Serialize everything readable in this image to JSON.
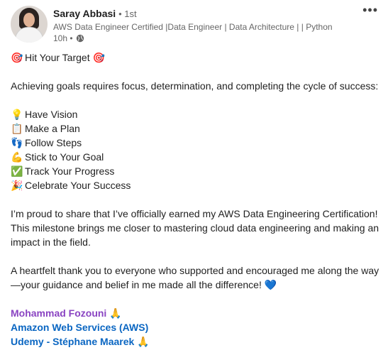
{
  "author": {
    "name": "Saray Abbasi",
    "degree": "• 1st",
    "headline": "AWS Data Engineer Certified |Data Engineer | Data Architecture | | Python",
    "time": "10h •"
  },
  "post": {
    "title": "Hit Your Target",
    "intro": "Achieving goals requires focus, determination, and completing the cycle of success:",
    "steps": [
      {
        "emoji": "💡",
        "label": "Have Vision"
      },
      {
        "emoji": "📋",
        "label": "Make a Plan"
      },
      {
        "emoji": "👣",
        "label": "Follow Steps"
      },
      {
        "emoji": "💪",
        "label": "Stick to Your Goal"
      },
      {
        "emoji": "✅",
        "label": "Track Your Progress"
      },
      {
        "emoji": "🎉",
        "label": "Celebrate Your Success"
      }
    ],
    "paragraph1": "I’m proud to share that I’ve officially earned my AWS Data Engineering Certification! This milestone brings me closer to mastering cloud data engineering and making an impact in the field.",
    "paragraph2": "A heartfelt thank you to everyone who supported and encouraged me along the way—your guidance and belief in me made all the difference!",
    "mentions": [
      {
        "name": "Mohammad Fozouni",
        "emoji": "🙏"
      },
      {
        "name": "Amazon Web Services (AWS)",
        "emoji": ""
      },
      {
        "name": "Udemy - Stéphane Maarek",
        "emoji": "🙏"
      }
    ]
  },
  "icons": {
    "target": "🎯",
    "heart": "💙",
    "more": "•••"
  }
}
